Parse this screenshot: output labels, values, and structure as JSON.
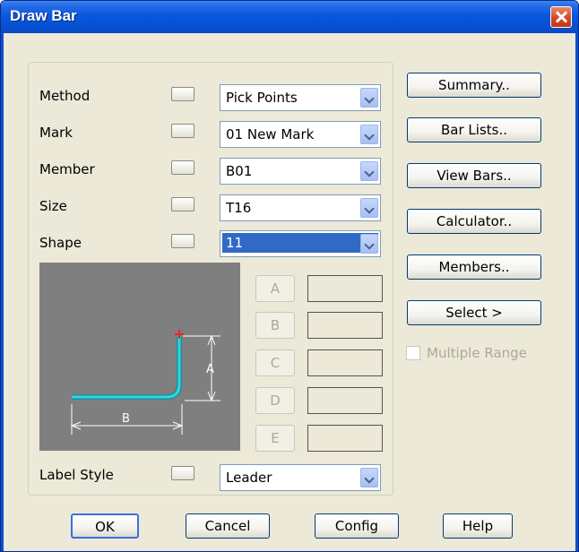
{
  "window": {
    "title": "Draw Bar"
  },
  "fields": [
    {
      "label": "Method",
      "value": "Pick Points"
    },
    {
      "label": "Mark",
      "value": "01 New Mark"
    },
    {
      "label": "Member",
      "value": "B01"
    },
    {
      "label": "Size",
      "value": "T16"
    },
    {
      "label": "Shape",
      "value": "11"
    }
  ],
  "label_style": {
    "label": "Label Style",
    "value": "Leader"
  },
  "dimensions": [
    {
      "letter": "A",
      "value": ""
    },
    {
      "letter": "B",
      "value": ""
    },
    {
      "letter": "C",
      "value": ""
    },
    {
      "letter": "D",
      "value": ""
    },
    {
      "letter": "E",
      "value": ""
    }
  ],
  "preview": {
    "dim_a": "A",
    "dim_b": "B",
    "bar_color": "#35d3e0",
    "background": "#7f7f7f"
  },
  "side_buttons": {
    "summary": "Summary..",
    "bar_lists": "Bar Lists..",
    "view_bars": "View Bars..",
    "calculator": "Calculator..",
    "members": "Members..",
    "select": "Select >"
  },
  "multiple_range": {
    "label": "Multiple Range",
    "checked": false,
    "enabled": false
  },
  "bottom_buttons": {
    "ok": "OK",
    "cancel": "Cancel",
    "config": "Config",
    "help": "Help"
  },
  "colors": {
    "titlebar": "#0a56dd",
    "dialog_bg": "#ece9d8",
    "selection": "#316ac5"
  }
}
